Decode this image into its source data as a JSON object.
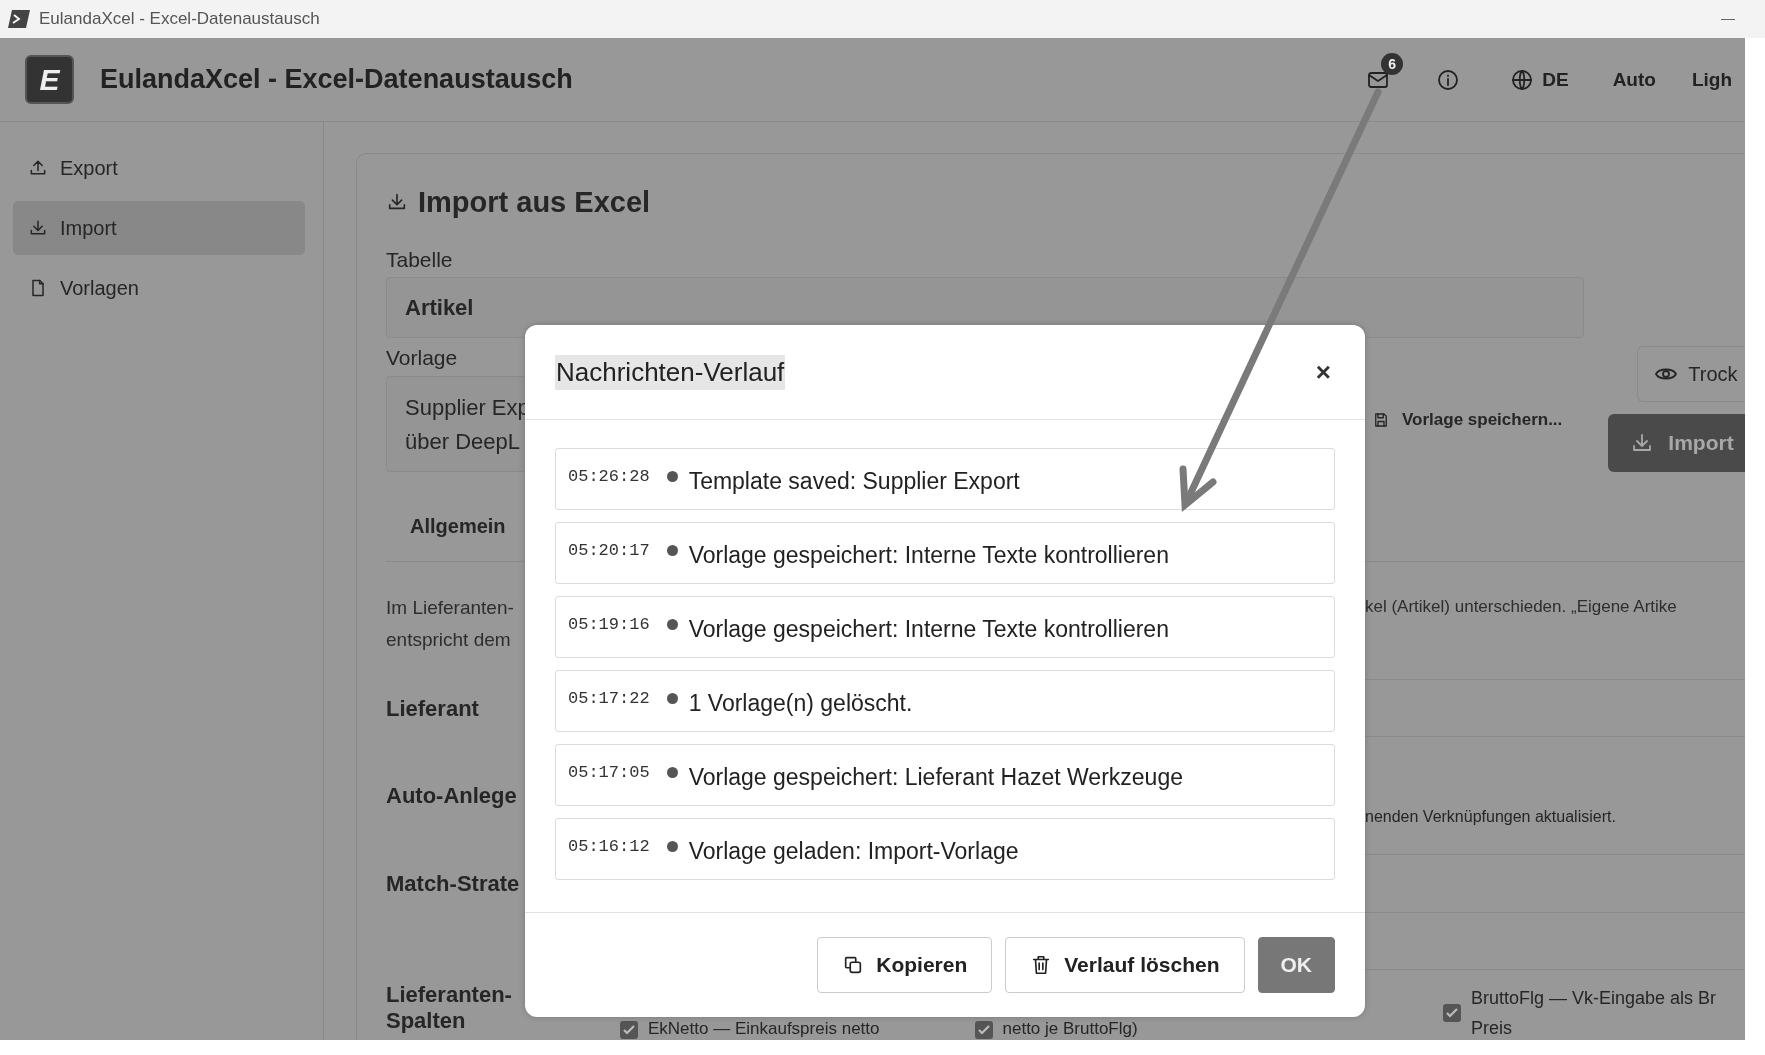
{
  "window": {
    "title": "EulandaXcel - Excel-Datenaustausch"
  },
  "header": {
    "logo_letter": "E",
    "title": "EulandaXcel - Excel-Datenaustausch",
    "message_count": "6",
    "language": "DE",
    "theme_options": [
      "Auto",
      "Ligh"
    ]
  },
  "sidebar": {
    "items": [
      {
        "kind": "export",
        "label": "Export",
        "selected": false
      },
      {
        "kind": "import",
        "label": "Import",
        "selected": true
      },
      {
        "kind": "templates",
        "label": "Vorlagen",
        "selected": false
      }
    ]
  },
  "import_panel": {
    "title": "Import aus Excel",
    "table_label": "Tabelle",
    "table_value": "Artikel",
    "template_label": "Vorlage",
    "template_value_lines": [
      "Supplier Exp",
      "über DeepL"
    ],
    "save_template": "Vorlage speichern...",
    "preview_button": "Trock",
    "import_button": "Import",
    "tab": "Allgemein",
    "description_left": [
      "Im Lieferanten-",
      "entspricht dem"
    ],
    "description_right": "kel (Artikel) unterschieden. „Eigene Artike",
    "sections": [
      {
        "label": "Lieferant"
      },
      {
        "label": "Auto-Anlege",
        "note": "nenden Verknüpfungen aktualisiert."
      },
      {
        "label": "Match-Strate"
      }
    ],
    "columns_label": [
      "Lieferanten-",
      "Spalten"
    ],
    "checkboxes": [
      {
        "lines": [
          "EkNetto — Einkaufspreis netto"
        ],
        "checked": true
      },
      {
        "lines": [
          "netto je BruttoFlg)"
        ],
        "checked": true
      },
      {
        "lines": [
          "BruttoFlg — Vk-Eingabe als Br",
          "Preis"
        ],
        "checked": true
      }
    ]
  },
  "dialog": {
    "title": "Nachrichten-Verlauf",
    "close": "×",
    "messages": [
      {
        "time": "05:26:28",
        "text": "Template saved: Supplier Export"
      },
      {
        "time": "05:20:17",
        "text": "Vorlage gespeichert: Interne Texte kontrollieren"
      },
      {
        "time": "05:19:16",
        "text": "Vorlage gespeichert: Interne Texte kontrollieren"
      },
      {
        "time": "05:17:22",
        "text": "1 Vorlage(n) gelöscht."
      },
      {
        "time": "05:17:05",
        "text": "Vorlage gespeichert: Lieferant Hazet Werkzeuge"
      },
      {
        "time": "05:16:12",
        "text": "Vorlage geladen: Import-Vorlage"
      }
    ],
    "buttons": [
      {
        "kind": "copy",
        "label": "Kopieren"
      },
      {
        "kind": "delete",
        "label": "Verlauf löschen"
      },
      {
        "kind": "primary",
        "label": "OK"
      }
    ]
  }
}
